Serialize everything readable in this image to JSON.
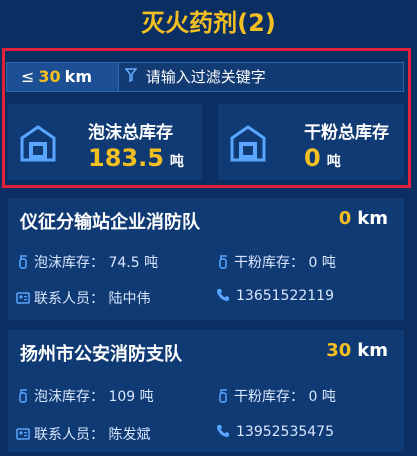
{
  "panel": {
    "title": "灭火药剂(2)"
  },
  "filter": {
    "distance_prefix": "≤",
    "distance_value": "30",
    "distance_unit": "km",
    "placeholder": "请输入过滤关键字"
  },
  "stock": {
    "foam": {
      "label": "泡沫总库存",
      "value": "183.5",
      "unit": "吨"
    },
    "powder": {
      "label": "干粉总库存",
      "value": "0",
      "unit": "吨"
    }
  },
  "teams": [
    {
      "name": "仪征分输站企业消防队",
      "distance": "0",
      "distance_unit": "km",
      "foam_label": "泡沫库存：",
      "foam_value": "74.5",
      "foam_unit": "吨",
      "powder_label": "干粉库存：",
      "powder_value": "0",
      "powder_unit": "吨",
      "contact_label": "联系人员：",
      "contact_name": "陆中伟",
      "phone": "13651522119"
    },
    {
      "name": "扬州市公安消防支队",
      "distance": "30",
      "distance_unit": "km",
      "foam_label": "泡沫库存：",
      "foam_value": "109",
      "foam_unit": "吨",
      "powder_label": "干粉库存：",
      "powder_value": "0",
      "powder_unit": "吨",
      "contact_label": "联系人员：",
      "contact_name": "陈发斌",
      "phone": "13952535475"
    }
  ],
  "colors": {
    "background": "#0b2f63",
    "accent": "#f3bf21",
    "highlight_border": "#e3223a",
    "card": "#0f3a73"
  },
  "icons": [
    "warehouse-icon",
    "filter-icon",
    "extinguisher-icon",
    "contact-card-icon",
    "phone-icon"
  ]
}
